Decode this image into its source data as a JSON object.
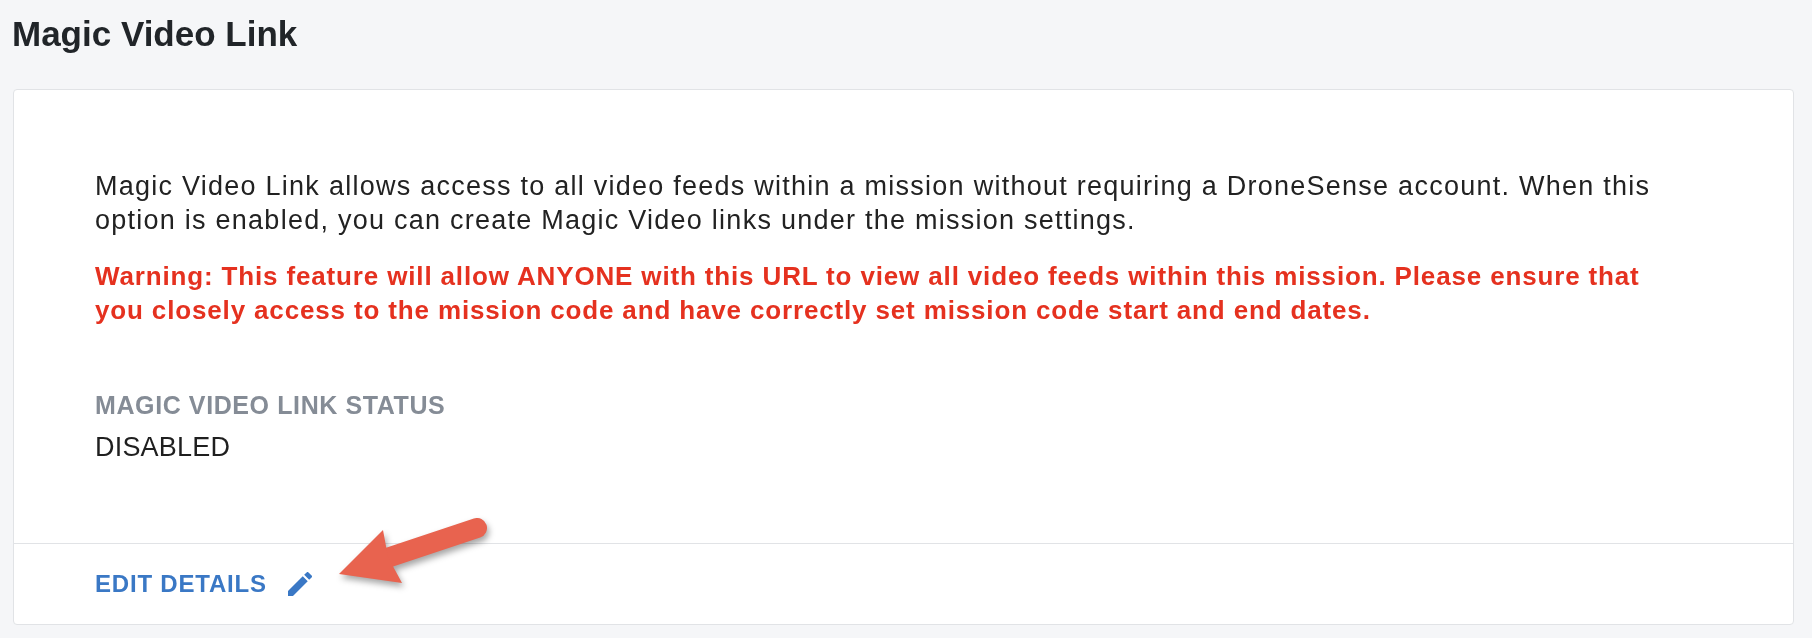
{
  "page": {
    "title": "Magic Video Link"
  },
  "card": {
    "description": "Magic Video Link allows access to all video feeds within a mission without requiring a DroneSense account. When this option is enabled, you can create Magic Video links under the mission settings.",
    "warning": "Warning: This feature will allow ANYONE with this URL to view all video feeds within this mission. Please ensure that you closely access to the mission code and have correctly set mission code start and end dates.",
    "status": {
      "label": "MAGIC VIDEO LINK STATUS",
      "value": "DISABLED"
    },
    "footer": {
      "action": {
        "label": "EDIT DETAILS"
      }
    }
  },
  "annotation": {
    "kind": "arrow"
  }
}
